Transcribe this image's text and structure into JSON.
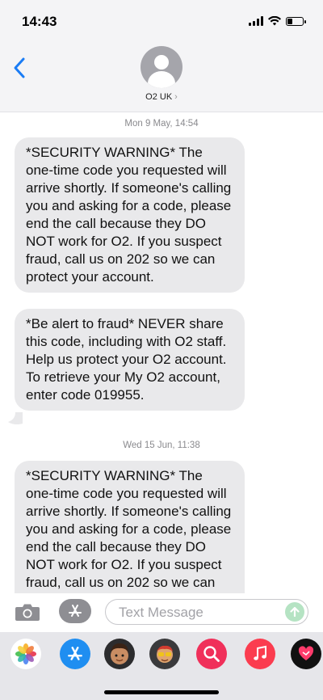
{
  "status_bar": {
    "time": "14:43",
    "battery_level": 0.35
  },
  "header": {
    "contact_name": "O2 UK",
    "chevron": "›",
    "back_icon": "chevron-left-icon",
    "avatar_icon": "person-icon"
  },
  "conversation": {
    "timestamp_1": "Mon 9 May, 14:54",
    "message_1": "*SECURITY WARNING* The one-time code you requested will arrive shortly. If someone's calling you and asking for a code, please end the call because they DO NOT work for O2. If you suspect fraud, call us on 202 so we can protect your account.",
    "message_2": "*Be alert to fraud* NEVER share this code, including with O2 staff. Help us protect your O2 account. To retrieve your My O2 account, enter code 019955.",
    "timestamp_2": "Wed 15 Jun, 11:38",
    "message_3": "*SECURITY WARNING* The one-time code you requested will arrive shortly. If someone's calling you and asking for a code, please end the call because they DO NOT work for O2. If you suspect fraud, call us on 202 so we can protect your account."
  },
  "compose": {
    "placeholder": "Text Message",
    "value": ""
  },
  "app_drawer": {
    "apps": [
      "photos-icon",
      "app-store-icon",
      "memoji-icon",
      "memoji-stickers-icon",
      "search-images-icon",
      "music-icon",
      "fitness-heart-icon"
    ]
  },
  "colors": {
    "bubble": "#e9e9eb",
    "ios_blue": "#1a7cf5",
    "send_green": "#b5e3c3",
    "bar_bg": "#f4f4f6"
  }
}
